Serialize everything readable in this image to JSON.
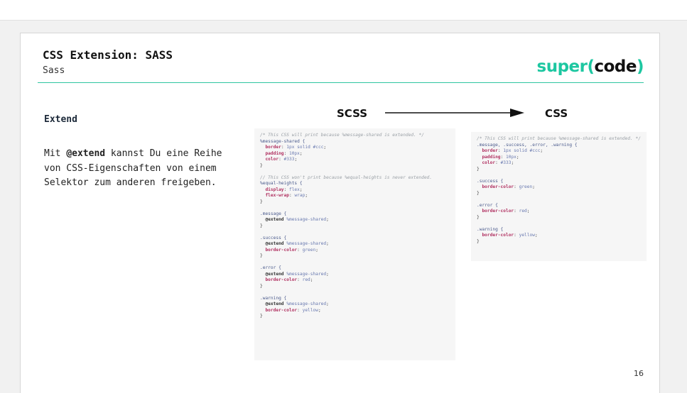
{
  "slide": {
    "title": "CSS Extension: SASS",
    "subtitle": "Sass",
    "logo": {
      "part1": "super(",
      "part2": "code",
      "part3": ")"
    },
    "section_title": "Extend",
    "body": {
      "prefix": "Mit ",
      "keyword": "@extend",
      "suffix": " kannst Du eine Reihe von CSS-Eigenschaften von einem Selektor zum anderen freigeben."
    },
    "flow": {
      "from": "SCSS",
      "to": "CSS"
    },
    "page_number": "16"
  },
  "colors": {
    "accent": "#1dc7a1",
    "divider": "#2ec6a0",
    "code_bg": "#f6f6f6"
  },
  "icons": [
    "arrow-right-icon"
  ],
  "scss_code": [
    [
      [
        "c",
        "/* This CSS will print because %message-shared is extended. */"
      ]
    ],
    [
      [
        "s",
        "%message-shared {"
      ]
    ],
    [
      [
        "p",
        "  border"
      ],
      [
        "t",
        ": "
      ],
      [
        "v",
        "1px solid #ccc"
      ],
      [
        "t",
        ";"
      ]
    ],
    [
      [
        "p",
        "  padding"
      ],
      [
        "t",
        ": "
      ],
      [
        "v",
        "10px"
      ],
      [
        "t",
        ";"
      ]
    ],
    [
      [
        "p",
        "  color"
      ],
      [
        "t",
        ": "
      ],
      [
        "v",
        "#333"
      ],
      [
        "t",
        ";"
      ]
    ],
    [
      [
        "t",
        "}"
      ]
    ],
    [
      [
        "t",
        ""
      ]
    ],
    [
      [
        "c",
        "// This CSS won't print because %equal-heights is never extended."
      ]
    ],
    [
      [
        "s",
        "%equal-heights {"
      ]
    ],
    [
      [
        "p",
        "  display"
      ],
      [
        "t",
        ": "
      ],
      [
        "v",
        "flex"
      ],
      [
        "t",
        ";"
      ]
    ],
    [
      [
        "p",
        "  flex-wrap"
      ],
      [
        "t",
        ": "
      ],
      [
        "v",
        "wrap"
      ],
      [
        "t",
        ";"
      ]
    ],
    [
      [
        "t",
        "}"
      ]
    ],
    [
      [
        "t",
        ""
      ]
    ],
    [
      [
        "s",
        ".message {"
      ]
    ],
    [
      [
        "k",
        "  @extend"
      ],
      [
        "v",
        " %message-shared"
      ],
      [
        "t",
        ";"
      ]
    ],
    [
      [
        "t",
        "}"
      ]
    ],
    [
      [
        "t",
        ""
      ]
    ],
    [
      [
        "s",
        ".success {"
      ]
    ],
    [
      [
        "k",
        "  @extend"
      ],
      [
        "v",
        " %message-shared"
      ],
      [
        "t",
        ";"
      ]
    ],
    [
      [
        "p",
        "  border-color"
      ],
      [
        "t",
        ": "
      ],
      [
        "v",
        "green"
      ],
      [
        "t",
        ";"
      ]
    ],
    [
      [
        "t",
        "}"
      ]
    ],
    [
      [
        "t",
        ""
      ]
    ],
    [
      [
        "s",
        ".error {"
      ]
    ],
    [
      [
        "k",
        "  @extend"
      ],
      [
        "v",
        " %message-shared"
      ],
      [
        "t",
        ";"
      ]
    ],
    [
      [
        "p",
        "  border-color"
      ],
      [
        "t",
        ": "
      ],
      [
        "v",
        "red"
      ],
      [
        "t",
        ";"
      ]
    ],
    [
      [
        "t",
        "}"
      ]
    ],
    [
      [
        "t",
        ""
      ]
    ],
    [
      [
        "s",
        ".warning {"
      ]
    ],
    [
      [
        "k",
        "  @extend"
      ],
      [
        "v",
        " %message-shared"
      ],
      [
        "t",
        ";"
      ]
    ],
    [
      [
        "p",
        "  border-color"
      ],
      [
        "t",
        ": "
      ],
      [
        "v",
        "yellow"
      ],
      [
        "t",
        ";"
      ]
    ],
    [
      [
        "t",
        "}"
      ]
    ]
  ],
  "css_code": [
    [
      [
        "c",
        "/* This CSS will print because %message-shared is extended. */"
      ]
    ],
    [
      [
        "s",
        ".message, .success, .error, .warning {"
      ]
    ],
    [
      [
        "p",
        "  border"
      ],
      [
        "t",
        ": "
      ],
      [
        "v",
        "1px solid #ccc"
      ],
      [
        "t",
        ";"
      ]
    ],
    [
      [
        "p",
        "  padding"
      ],
      [
        "t",
        ": "
      ],
      [
        "v",
        "10px"
      ],
      [
        "t",
        ";"
      ]
    ],
    [
      [
        "p",
        "  color"
      ],
      [
        "t",
        ": "
      ],
      [
        "v",
        "#333"
      ],
      [
        "t",
        ";"
      ]
    ],
    [
      [
        "t",
        "}"
      ]
    ],
    [
      [
        "t",
        ""
      ]
    ],
    [
      [
        "s",
        ".success {"
      ]
    ],
    [
      [
        "p",
        "  border-color"
      ],
      [
        "t",
        ": "
      ],
      [
        "v",
        "green"
      ],
      [
        "t",
        ";"
      ]
    ],
    [
      [
        "t",
        "}"
      ]
    ],
    [
      [
        "t",
        ""
      ]
    ],
    [
      [
        "s",
        ".error {"
      ]
    ],
    [
      [
        "p",
        "  border-color"
      ],
      [
        "t",
        ": "
      ],
      [
        "v",
        "red"
      ],
      [
        "t",
        ";"
      ]
    ],
    [
      [
        "t",
        "}"
      ]
    ],
    [
      [
        "t",
        ""
      ]
    ],
    [
      [
        "s",
        ".warning {"
      ]
    ],
    [
      [
        "p",
        "  border-color"
      ],
      [
        "t",
        ": "
      ],
      [
        "v",
        "yellow"
      ],
      [
        "t",
        ";"
      ]
    ],
    [
      [
        "t",
        "}"
      ]
    ]
  ]
}
